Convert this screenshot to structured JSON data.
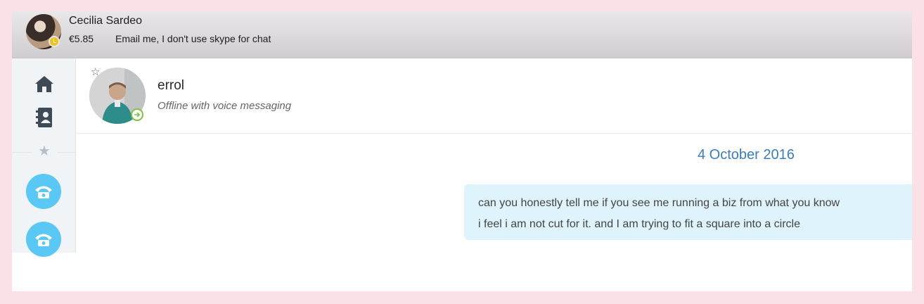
{
  "profile": {
    "name": "Cecilia Sardeo",
    "credit": "€5.85",
    "mood_message": "Email me, I don't use skype for chat",
    "status": "away"
  },
  "sidebar": {
    "items": [
      {
        "icon": "home-icon"
      },
      {
        "icon": "contacts-icon"
      },
      {
        "icon": "star-icon"
      },
      {
        "icon": "phone-icon"
      },
      {
        "icon": "phone-icon"
      }
    ]
  },
  "contact": {
    "name": "errol",
    "status": "Offline with voice messaging"
  },
  "conversation": {
    "date": "4 October 2016",
    "messages": [
      {
        "lines": [
          "can you honestly tell me if you see me running a biz from what you know",
          "i feel i am not cut for it. and I am trying to fit a square into a circle"
        ]
      }
    ]
  },
  "colors": {
    "accent": "#5ac8f5",
    "date": "#3a7dbf",
    "bubble": "#dff3fd",
    "online_ring": "#7cc242",
    "away": "#f3c216"
  }
}
